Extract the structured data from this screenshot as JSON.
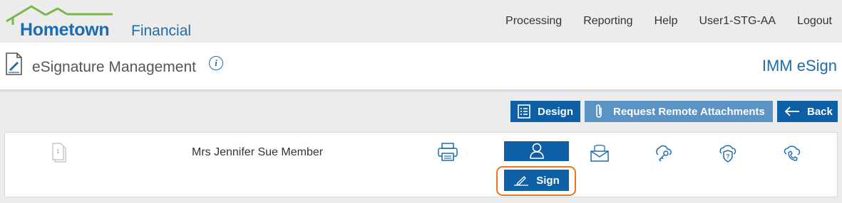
{
  "app": {
    "logo_main": "Hometown",
    "logo_sub": "Financial"
  },
  "nav": {
    "items": [
      {
        "label": "Processing"
      },
      {
        "label": "Reporting"
      },
      {
        "label": "Help"
      },
      {
        "label": "User1-STG-AA"
      },
      {
        "label": "Logout"
      }
    ]
  },
  "header": {
    "title": "eSignature Management",
    "info_icon": "i",
    "brand_right": "IMM eSign"
  },
  "toolbar": {
    "design_label": "Design",
    "attachments_label": "Request Remote Attachments",
    "back_label": "Back"
  },
  "signer": {
    "name": "Mrs Jennifer Sue Member",
    "doc_count": "1",
    "sign_label": "Sign"
  },
  "colors": {
    "accent": "#0d5fa6",
    "accent_light": "#5b93c4",
    "logo_roof": "#7ab648",
    "highlight": "#e87722"
  },
  "icons": [
    "house-roof-icon",
    "signature-document-icon",
    "info-icon",
    "list-icon",
    "paperclip-icon",
    "arrow-left-icon",
    "document-count-icon",
    "printer-icon",
    "person-icon",
    "envelope-icon",
    "key-icon",
    "shield-question-icon",
    "phone-support-icon",
    "pen-icon"
  ]
}
